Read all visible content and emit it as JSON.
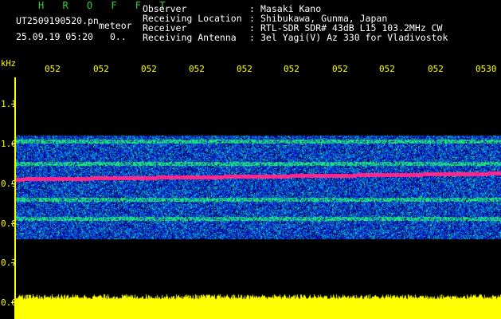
{
  "header": {
    "station_title": "H R O F F T",
    "filename": "UT2509190520.pn",
    "mode": "meteor",
    "datetime": "25.09.19 05:20",
    "counter": "0..",
    "info": [
      {
        "label": "Observer",
        "value": "Masaki Kano"
      },
      {
        "label": "Receiving Location",
        "value": "Shibukawa, Gunma, Japan"
      },
      {
        "label": "Receiver",
        "value": "RTL-SDR SDR# 43dB L15 103.2MHz CW"
      },
      {
        "label": "Receiving Antenna",
        "value": "3el Yagi(V) Az 330 for Vladivostok"
      }
    ]
  },
  "axis": {
    "y_unit": "kHz",
    "y_labels": [
      "1.1",
      "1.0",
      "0.9",
      "0.8",
      "0.7",
      "0.6"
    ],
    "x_labels": [
      "052",
      "052",
      "052",
      "052",
      "052",
      "052",
      "052",
      "052",
      "052",
      "0530"
    ]
  },
  "colors": {
    "background": "#000000",
    "title_green": "#2fd23a",
    "axis_yellow": "#ffff00",
    "signal_red": "#ff1a8c",
    "noise_blue": "#0a2cd8",
    "noise_green": "#22e070"
  },
  "spectrogram": {
    "noise_band_khz": [
      0.76,
      1.02
    ],
    "signal_lines_khz": [
      0.91,
      0.86,
      0.81,
      0.95,
      1.005
    ],
    "power_trace_baseline_khz": 0.6
  }
}
